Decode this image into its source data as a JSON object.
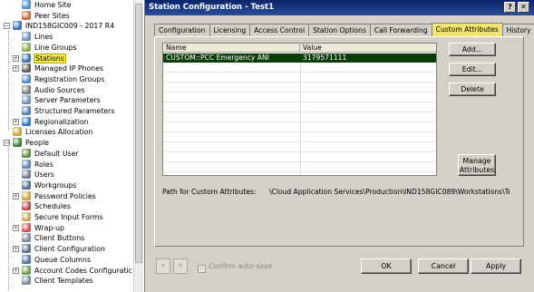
{
  "tree": {
    "items": [
      {
        "label": "Home Site",
        "icon": "home-site-icon",
        "expander": "",
        "color": "#4a8fd0"
      },
      {
        "label": "Peer Sites",
        "icon": "peer-sites-icon",
        "expander": "",
        "color": "#c86a3a"
      },
      {
        "label": "IND158GIC009 - 2017 R4",
        "icon": "server-icon",
        "expander": "−",
        "color": "#3a6db5"
      },
      {
        "label": "Lines",
        "icon": "lines-icon",
        "expander": "",
        "color": "#6a8fb8"
      },
      {
        "label": "Line Groups",
        "icon": "line-groups-icon",
        "expander": "",
        "color": "#8fa94e"
      },
      {
        "label": "Stations",
        "icon": "stations-icon",
        "expander": "+",
        "color": "#3c6ea8",
        "selected": true
      },
      {
        "label": "Managed IP Phones",
        "icon": "ip-phone-icon",
        "expander": "+",
        "color": "#5a5a5a"
      },
      {
        "label": "Registration Groups",
        "icon": "registration-groups-icon",
        "expander": "",
        "color": "#4f8ac9"
      },
      {
        "label": "Audio Sources",
        "icon": "audio-sources-icon",
        "expander": "",
        "color": "#7a7a7a"
      },
      {
        "label": "Server Parameters",
        "icon": "server-parameters-icon",
        "expander": "",
        "color": "#6d8fb5"
      },
      {
        "label": "Structured Parameters",
        "icon": "structured-parameters-icon",
        "expander": "",
        "color": "#4e7fb3"
      },
      {
        "label": "Regionalization",
        "icon": "globe-icon",
        "expander": "+",
        "color": "#2e7bc8"
      },
      {
        "label": "Licenses Allocation",
        "icon": "licenses-icon",
        "expander": "",
        "color": "#c9a23c"
      },
      {
        "label": "People",
        "icon": "people-icon",
        "expander": "−",
        "color": "#3f7e3a"
      },
      {
        "label": "Default User",
        "icon": "default-user-icon",
        "expander": "",
        "color": "#5e8a3c"
      },
      {
        "label": "Roles",
        "icon": "roles-icon",
        "expander": "",
        "color": "#5d7fb0"
      },
      {
        "label": "Users",
        "icon": "users-icon",
        "expander": "",
        "color": "#6a7c9a"
      },
      {
        "label": "Workgroups",
        "icon": "workgroups-icon",
        "expander": "",
        "color": "#4d6e8f"
      },
      {
        "label": "Password Policies",
        "icon": "password-policies-icon",
        "expander": "+",
        "color": "#c8a23a"
      },
      {
        "label": "Schedules",
        "icon": "schedules-icon",
        "expander": "",
        "color": "#b74a4a"
      },
      {
        "label": "Secure Input Forms",
        "icon": "secure-input-forms-icon",
        "expander": "",
        "color": "#c9a65a"
      },
      {
        "label": "Wrap-up",
        "icon": "wrap-up-icon",
        "expander": "+",
        "color": "#c85050"
      },
      {
        "label": "Client Buttons",
        "icon": "client-buttons-icon",
        "expander": "",
        "color": "#7a8a9a"
      },
      {
        "label": "Client Configuration",
        "icon": "client-configuration-icon",
        "expander": "+",
        "color": "#5a6f8a"
      },
      {
        "label": "Queue Columns",
        "icon": "queue-columns-icon",
        "expander": "",
        "color": "#4f6fa0"
      },
      {
        "label": "Account Codes Configuratic",
        "icon": "account-codes-icon",
        "expander": "+",
        "color": "#6f9a4a"
      },
      {
        "label": "Client Templates",
        "icon": "client-templates-icon",
        "expander": "",
        "color": "#7a8a9a"
      }
    ]
  },
  "dialog": {
    "title": "Station Configuration - Test1",
    "help_button": "?",
    "close_button": "✕",
    "tabs": [
      {
        "label": "Configuration"
      },
      {
        "label": "Licensing"
      },
      {
        "label": "Access Control"
      },
      {
        "label": "Station Options"
      },
      {
        "label": "Call Forwarding"
      },
      {
        "label": "Custom Attributes",
        "active": true
      },
      {
        "label": "History"
      }
    ],
    "grid": {
      "columns": [
        "Name",
        "Value"
      ],
      "rows": [
        {
          "name": "CUSTOM::PCC Emergency ANI",
          "value": "3179571111"
        }
      ]
    },
    "side_buttons": {
      "add": "Add...",
      "edit": "Edit...",
      "delete": "Delete",
      "manage_line1": "Manage",
      "manage_line2": "Attributes"
    },
    "path_label": "Path for Custom Attributes:",
    "path_value": "\\Cloud Application Services\\Production\\IND158GIC089\\Workstations\\Te",
    "footer": {
      "back": "«",
      "forward": "»",
      "confirm_label": "Confirm auto-save",
      "confirm_checked": true,
      "ok": "OK",
      "cancel": "Cancel",
      "apply": "Apply"
    }
  },
  "colors": {
    "title_bar": "#0a246a",
    "active_tab": "#f2e46e",
    "selected_row": "#0c3d0a",
    "selected_tree_item": "#f5ec42"
  }
}
